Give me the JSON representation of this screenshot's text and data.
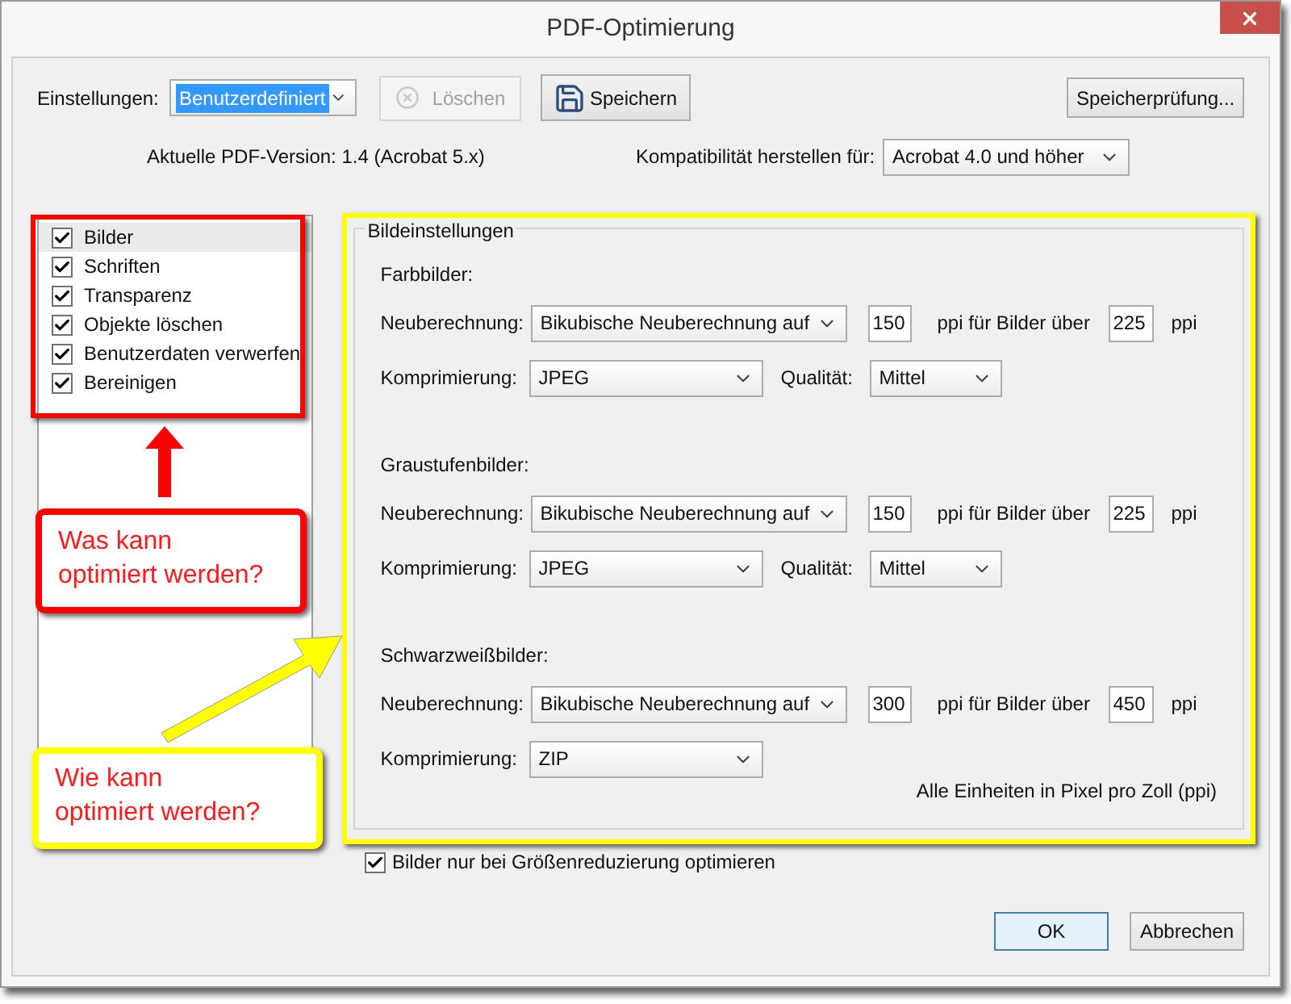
{
  "window": {
    "title": "PDF-Optimierung"
  },
  "settings": {
    "label": "Einstellungen:",
    "value": "Benutzerdefiniert"
  },
  "toolbar_buttons": [
    {
      "kind": "delete",
      "label": "Löschen",
      "disabled": true
    },
    {
      "kind": "save",
      "label": "Speichern",
      "disabled": false
    },
    {
      "kind": "plain",
      "label": "Speicherprüfung...",
      "disabled": false
    }
  ],
  "version_text": "Aktuelle PDF-Version: 1.4 (Acrobat 5.x)",
  "compatibility": {
    "label": "Kompatibilität herstellen für:",
    "value": "Acrobat 4.0 und höher"
  },
  "panels": [
    {
      "label": "Bilder",
      "checked": true,
      "selected": true
    },
    {
      "label": "Schriften",
      "checked": true,
      "selected": false
    },
    {
      "label": "Transparenz",
      "checked": true,
      "selected": false
    },
    {
      "label": "Objekte löschen",
      "checked": true,
      "selected": false
    },
    {
      "label": "Benutzerdaten verwerfen",
      "checked": true,
      "selected": false
    },
    {
      "label": "Bereinigen",
      "checked": true,
      "selected": false
    }
  ],
  "image_settings": {
    "title": "Bildeinstellungen",
    "groups": [
      {
        "heading": "Farbbilder:",
        "resample": {
          "label": "Neuberechnung:",
          "method": "Bikubische Neuberechnung auf",
          "ppi": "150",
          "ppi_label": "ppi für Bilder über",
          "above": "225",
          "unit": "ppi"
        },
        "compression": {
          "label": "Komprimierung:",
          "value": "JPEG"
        },
        "quality": {
          "label": "Qualität:",
          "value": "Mittel"
        }
      },
      {
        "heading": "Graustufenbilder:",
        "resample": {
          "label": "Neuberechnung:",
          "method": "Bikubische Neuberechnung auf",
          "ppi": "150",
          "ppi_label": "ppi für Bilder über",
          "above": "225",
          "unit": "ppi"
        },
        "compression": {
          "label": "Komprimierung:",
          "value": "JPEG"
        },
        "quality": {
          "label": "Qualität:",
          "value": "Mittel"
        }
      },
      {
        "heading": "Schwarzweißbilder:",
        "resample": {
          "label": "Neuberechnung:",
          "method": "Bikubische Neuberechnung auf",
          "ppi": "300",
          "ppi_label": "ppi für Bilder über",
          "above": "450",
          "unit": "ppi"
        },
        "compression": {
          "label": "Komprimierung:",
          "value": "ZIP"
        }
      }
    ],
    "note": "Alle Einheiten in Pixel pro Zoll (ppi)"
  },
  "optimize_only": {
    "label": "Bilder nur bei Größenreduzierung optimieren",
    "checked": true
  },
  "footer_buttons": [
    {
      "label": "OK",
      "default": true
    },
    {
      "label": "Abbrechen",
      "default": false
    }
  ],
  "annotations": [
    {
      "kind": "list",
      "color": "#ff0000",
      "lines": [
        "Was kann",
        "optimiert werden?"
      ]
    },
    {
      "kind": "settings",
      "color": "#ffff00",
      "lines": [
        "Wie kann",
        "optimiert werden?"
      ]
    }
  ]
}
